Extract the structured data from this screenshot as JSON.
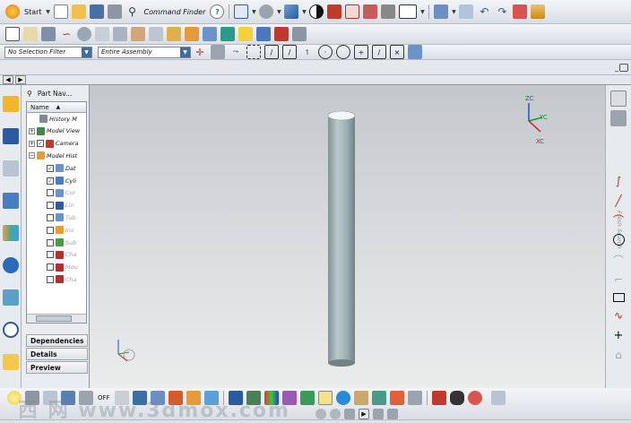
{
  "toolbar_top": {
    "start_label": "Start",
    "command_finder_label": "Command Finder"
  },
  "filters": {
    "selection_filter": "No Selection Filter",
    "assembly_scope": "Entire Assembly"
  },
  "part_navigator": {
    "title": "Part Nav...",
    "column_name": "Name",
    "items": [
      {
        "label": "History M",
        "checked": null,
        "dim": false
      },
      {
        "label": "Model View",
        "checked": null,
        "dim": false
      },
      {
        "label": "Camera",
        "checked": true,
        "dim": false
      },
      {
        "label": "Model Hist",
        "checked": null,
        "dim": false
      },
      {
        "label": "Dat",
        "checked": true,
        "dim": false
      },
      {
        "label": "Cyli",
        "checked": true,
        "dim": false
      },
      {
        "label": "Cur",
        "checked": false,
        "dim": true
      },
      {
        "label": "Lin",
        "checked": false,
        "dim": true
      },
      {
        "label": "Tub",
        "checked": false,
        "dim": true
      },
      {
        "label": "Ins",
        "checked": false,
        "dim": true
      },
      {
        "label": "Sub",
        "checked": false,
        "dim": true
      },
      {
        "label": "Cha",
        "checked": false,
        "dim": true
      },
      {
        "label": "Mou",
        "checked": false,
        "dim": true
      },
      {
        "label": "Cha",
        "checked": false,
        "dim": true
      }
    ],
    "panels": {
      "dependencies": "Dependencies",
      "details": "Details",
      "preview": "Preview"
    }
  },
  "viewport": {
    "triad_labels": {
      "zc": "ZC",
      "yc": "YC",
      "xc": "XC"
    },
    "solid_color": "#a8b8bb"
  },
  "palette": {
    "fresh_search_label": "Fresh Search"
  },
  "watermark": "西 网  www.3dmox.com",
  "bottom_toolbar": {
    "off_label": "OFF"
  },
  "colors": {
    "accent_blue": "#3a6ea5",
    "check_green": "#1a8a1a"
  }
}
